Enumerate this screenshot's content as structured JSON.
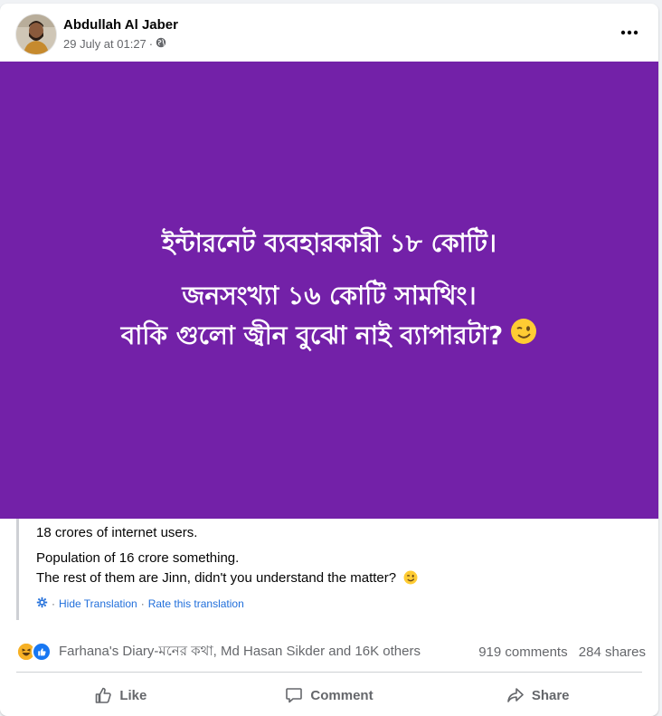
{
  "post": {
    "author": "Abdullah Al Jaber",
    "timestamp": "29 July at 01:27",
    "audience_icon": "globe-icon",
    "more_icon": "more-options-icon",
    "background_color": "#7321a8",
    "image_text": {
      "line1": "ইন্টারনেট ব্যবহারকারী ১৮ কোটি।",
      "line2": "জনসংখ্যা ১৬ কোটি সামথিং।",
      "line3": "বাকি গুলো জ্বীন বুঝো নাই ব্যাপারটা?"
    },
    "translation": {
      "line1": "18 crores of internet users.",
      "line2": "Population of 16 crore something.",
      "line3": "The rest of them are Jinn, didn't you understand the matter?",
      "hide_label": "Hide Translation",
      "rate_label": "Rate this translation"
    },
    "reactions": {
      "icons": [
        "haha-icon",
        "like-icon"
      ],
      "names": "Farhana's Diary-মনের কথা, Md Hasan Sikder and 16K others",
      "comments": "919 comments",
      "shares": "284 shares"
    },
    "actions": {
      "like": "Like",
      "comment": "Comment",
      "share": "Share"
    }
  },
  "colors": {
    "link_blue": "#216fdb",
    "secondary_text": "#65676b",
    "like_blue": "#1877f2",
    "haha_yellow": "#f7b125"
  }
}
